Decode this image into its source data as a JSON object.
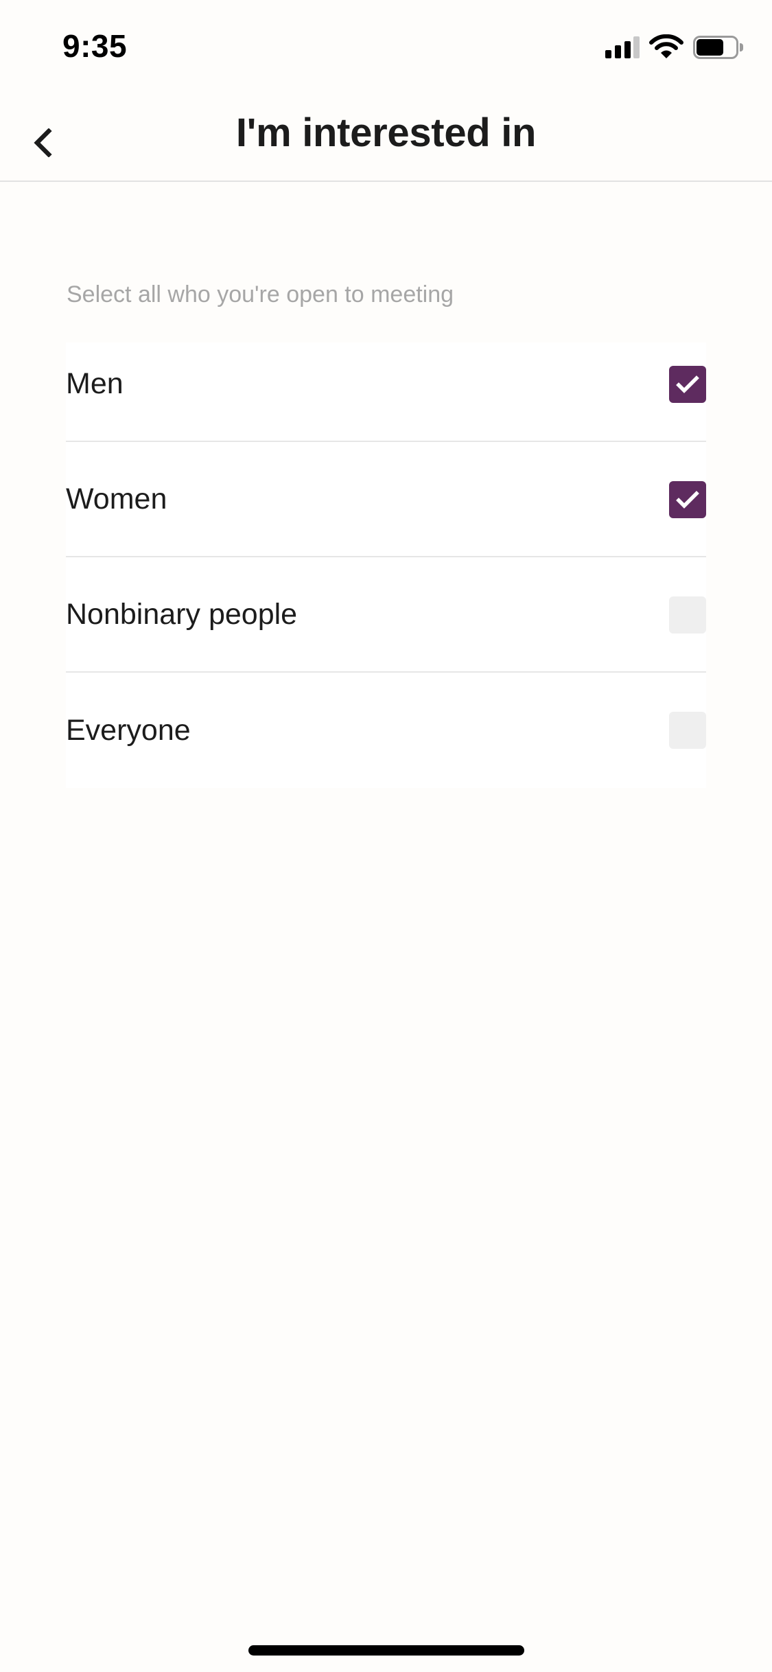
{
  "status_bar": {
    "time": "9:35",
    "signal_bars_active": 3,
    "signal_bars_total": 4,
    "battery_level": 0.7
  },
  "nav": {
    "back_icon": "chevron-left-icon",
    "title": "I'm interested in"
  },
  "subtitle": "Select all who you're open to meeting",
  "accent_color": "#5e2b5f",
  "options": [
    {
      "label": "Men",
      "checked": true
    },
    {
      "label": "Women",
      "checked": true
    },
    {
      "label": "Nonbinary people",
      "checked": false
    },
    {
      "label": "Everyone",
      "checked": false
    }
  ]
}
